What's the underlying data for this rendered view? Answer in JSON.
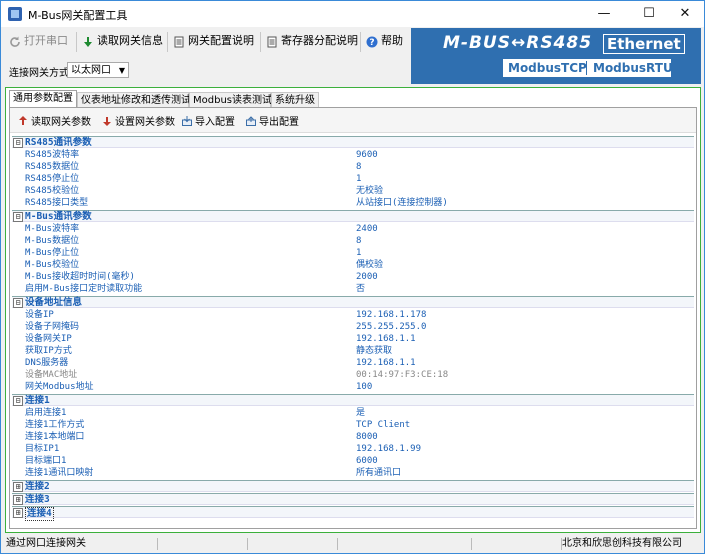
{
  "window": {
    "title": "M-Bus网关配置工具",
    "minimize": "—",
    "maximize": "☐",
    "close": "✕"
  },
  "toolbar": {
    "open_port": "打开串口",
    "read_info": "读取网关信息",
    "config_guide": "网关配置说明",
    "register_guide": "寄存器分配说明",
    "help": "帮助"
  },
  "banner": {
    "title": "M-BUS↔RS485",
    "ethernet": "Ethernet",
    "modbus_tcp": "ModbusTCP",
    "modbus_rtu": "ModbusRTU"
  },
  "connection": {
    "label": "连接网关方式",
    "value": "以太网口"
  },
  "tabs": [
    "通用参数配置",
    "仪表地址修改和透传测试",
    "Modbus读表测试",
    "系统升级"
  ],
  "subtoolbar": {
    "read_params": "读取网关参数",
    "set_params": "设置网关参数",
    "import": "导入配置",
    "export": "导出配置"
  },
  "sections": [
    {
      "title": "RS485通讯参数",
      "toggle": "⊟",
      "rows": [
        {
          "k": "RS485波特率",
          "v": "9600"
        },
        {
          "k": "RS485数据位",
          "v": "8"
        },
        {
          "k": "RS485停止位",
          "v": "1"
        },
        {
          "k": "RS485校验位",
          "v": "无校验"
        },
        {
          "k": "RS485接口类型",
          "v": "从站接口(连接控制器)"
        }
      ]
    },
    {
      "title": "M-Bus通讯参数",
      "toggle": "⊟",
      "rows": [
        {
          "k": "M-Bus波特率",
          "v": "2400"
        },
        {
          "k": "M-Bus数据位",
          "v": "8"
        },
        {
          "k": "M-Bus停止位",
          "v": "1"
        },
        {
          "k": "M-Bus校验位",
          "v": "偶校验"
        },
        {
          "k": "M-Bus接收超时时间(毫秒)",
          "v": "2000"
        },
        {
          "k": "启用M-Bus接口定时读取功能",
          "v": "否"
        }
      ]
    },
    {
      "title": "设备地址信息",
      "toggle": "⊟",
      "rows": [
        {
          "k": "设备IP",
          "v": "192.168.1.178"
        },
        {
          "k": "设备子网掩码",
          "v": "255.255.255.0"
        },
        {
          "k": "设备网关IP",
          "v": "192.168.1.1"
        },
        {
          "k": "获取IP方式",
          "v": "静态获取"
        },
        {
          "k": "DNS服务器",
          "v": "192.168.1.1"
        },
        {
          "k": "设备MAC地址",
          "v": "00:14:97:F3:CE:18",
          "grey": true
        },
        {
          "k": "网关Modbus地址",
          "v": "100"
        }
      ]
    },
    {
      "title": "连接1",
      "toggle": "⊟",
      "rows": [
        {
          "k": "启用连接1",
          "v": "是"
        },
        {
          "k": "连接1工作方式",
          "v": "TCP Client"
        },
        {
          "k": "连接1本地端口",
          "v": "8000"
        },
        {
          "k": "目标IP1",
          "v": "192.168.1.99"
        },
        {
          "k": "目标端口1",
          "v": "6000"
        },
        {
          "k": "连接1通讯口映射",
          "v": "所有通讯口"
        }
      ]
    },
    {
      "title": "连接2",
      "toggle": "⊞",
      "rows": []
    },
    {
      "title": "连接3",
      "toggle": "⊞",
      "rows": []
    },
    {
      "title": "连接4",
      "toggle": "⊞",
      "rows": []
    }
  ],
  "status": {
    "left": "通过网口连接网关",
    "right": "北京和欣思创科技有限公司"
  }
}
